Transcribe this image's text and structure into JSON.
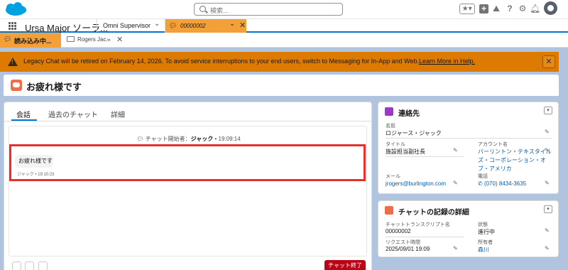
{
  "header": {
    "search_placeholder": "検索...",
    "icons": [
      "salesforce-logo",
      "favorites-star-icon",
      "add-icon",
      "trailhead-icon",
      "help-icon",
      "gear-icon",
      "bell-icon",
      "avatar"
    ]
  },
  "app_nav": {
    "app_name": "Ursa Major ソーラ...",
    "tab_omni": "Omni Supervisor",
    "tab_active": "00000002"
  },
  "subtabs": {
    "loading": "読み込み中...",
    "rogers": "Rogers Jac..."
  },
  "banner": {
    "text": "Legacy Chat will be retired on February 14, 2026. To avoid service interruptions to your end users, switch to Messaging for In-App and Web.",
    "link": "Learn More in Help.",
    "close": "✕"
  },
  "record": {
    "title": "お疲れ様です"
  },
  "main": {
    "tabs": [
      "会話",
      "過去のチャット",
      "詳細"
    ],
    "chat_start_prefix": "チャット開始者：",
    "chat_start_name": "ジャック",
    "chat_start_time": "• 19:09:14",
    "message_text": "お疲れ様です",
    "message_meta": "ジャック • 19:10:23",
    "end_chat_button": "チャット終了"
  },
  "contact": {
    "title": "連絡先",
    "name_label": "名前",
    "name_value": "ロジャース・ジャック",
    "title_label": "タイトル",
    "title_value": "施設担当副社長",
    "account_label": "アカウント名",
    "account_value_1": "バーリントン・テキスタイル",
    "account_value_2": "ズ・コーポレーション・オ",
    "account_value_3": "ブ・アメリカ",
    "email_label": "メール",
    "email_value": "jrogers@burlington.com",
    "phone_label": "電話",
    "phone_value": "(070) 8434-3635"
  },
  "chat_details": {
    "title": "チャットの記録の詳細",
    "transcript_label": "チャットトランスクリプト名",
    "transcript_value": "00000002",
    "status_label": "状態",
    "status_value": "進行中",
    "request_label": "リクエスト時間",
    "request_value": "2025/09/01 19:09",
    "owner_label": "所有者",
    "owner_value": "森川"
  },
  "colors": {
    "accent": "#0176d3",
    "tab_orange": "#f2a037",
    "banner": "#dd7a01",
    "end_chat": "#ba0517",
    "highlight": "#e5302b"
  }
}
